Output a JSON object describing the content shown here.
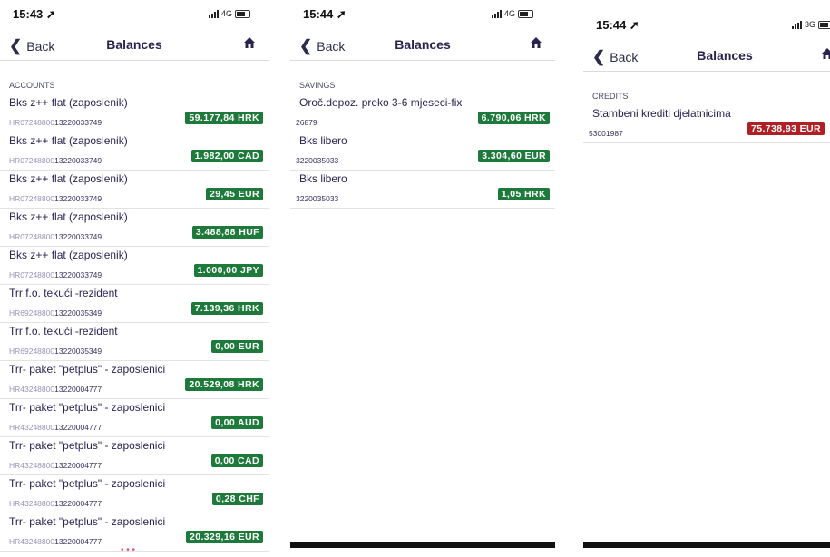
{
  "colors": {
    "positive": "#1e7a3a",
    "negative": "#b01f24",
    "title": "#2a2350"
  },
  "screens": [
    {
      "status": {
        "time": "15:43 ➚",
        "network": "4G"
      },
      "nav": {
        "back": "Back",
        "title": "Balances",
        "home_icon": "home-icon"
      },
      "section": "ACCOUNTS",
      "rows": [
        {
          "name": "Bks z++ flat (zaposlenik)",
          "iban_prefix": "HR07248800",
          "iban_rest": "13220033749",
          "amount": "59.177,84 HRK"
        },
        {
          "name": "Bks z++ flat (zaposlenik)",
          "iban_prefix": "HR07248800",
          "iban_rest": "13220033749",
          "amount": "1.982,00 CAD"
        },
        {
          "name": "Bks z++ flat (zaposlenik)",
          "iban_prefix": "HR07248800",
          "iban_rest": "13220033749",
          "amount": "29,45 EUR"
        },
        {
          "name": "Bks z++ flat (zaposlenik)",
          "iban_prefix": "HR07248800",
          "iban_rest": "13220033749",
          "amount": "3.488,88 HUF"
        },
        {
          "name": "Bks z++ flat (zaposlenik)",
          "iban_prefix": "HR07248800",
          "iban_rest": "13220033749",
          "amount": "1.000,00 JPY"
        },
        {
          "name": "Trr f.o. tekući -rezident",
          "iban_prefix": "HR69248800",
          "iban_rest": "13220035349",
          "amount": "7.139,36 HRK"
        },
        {
          "name": "Trr f.o. tekući -rezident",
          "iban_prefix": "HR69248800",
          "iban_rest": "13220035349",
          "amount": "0,00 EUR"
        },
        {
          "name": "Trr- paket  \"petplus\" - zaposlenici",
          "iban_prefix": "HR43248800",
          "iban_rest": "13220004777",
          "amount": "20.529,08 HRK"
        },
        {
          "name": "Trr- paket  \"petplus\" - zaposlenici",
          "iban_prefix": "HR43248800",
          "iban_rest": "13220004777",
          "amount": "0,00 AUD"
        },
        {
          "name": "Trr- paket  \"petplus\" - zaposlenici",
          "iban_prefix": "HR43248800",
          "iban_rest": "13220004777",
          "amount": "0,00 CAD"
        },
        {
          "name": "Trr- paket  \"petplus\" - zaposlenici",
          "iban_prefix": "HR43248800",
          "iban_rest": "13220004777",
          "amount": "0,28 CHF"
        },
        {
          "name": "Trr- paket  \"petplus\" - zaposlenici",
          "iban_prefix": "HR43248800",
          "iban_rest": "13220004777",
          "amount": "20.329,16 EUR"
        }
      ]
    },
    {
      "status": {
        "time": "15:44 ➚",
        "network": "4G"
      },
      "nav": {
        "back": "Back",
        "title": "Balances",
        "home_icon": "home-icon"
      },
      "section": "SAVINGS",
      "rows": [
        {
          "name": "Oroč.depoz. preko 3-6 mjeseci-fix",
          "number": "26879",
          "amount": "6.790,06 HRK"
        },
        {
          "name": "Bks libero",
          "number": "3220035033",
          "amount": "3.304,60 EUR"
        },
        {
          "name": "Bks libero",
          "number": "3220035033",
          "amount": "1,05 HRK"
        }
      ]
    },
    {
      "status": {
        "time": "15:44 ➚",
        "network": "3G"
      },
      "nav": {
        "back": "Back",
        "title": "Balances",
        "home_icon": "home-icon"
      },
      "section": "CREDITS",
      "rows": [
        {
          "name": "Stambeni krediti djelatnicima",
          "number": "53001987",
          "amount": "75.738,93 EUR"
        }
      ]
    }
  ]
}
